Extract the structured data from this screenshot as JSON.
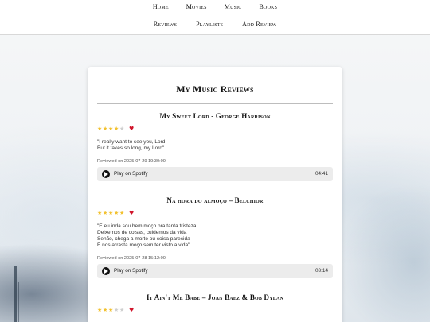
{
  "topnav": [
    {
      "label": "Home"
    },
    {
      "label": "Movies"
    },
    {
      "label": "Music"
    },
    {
      "label": "Books"
    }
  ],
  "subnav": [
    {
      "label": "Reviews"
    },
    {
      "label": "Playlists"
    },
    {
      "label": "Add Review"
    }
  ],
  "page": {
    "title": "My Music Reviews"
  },
  "reviews": [
    {
      "title": "My Sweet Lord - George Harrison",
      "rating": 4,
      "max_rating": 5,
      "favorite": true,
      "quote_lines": [
        "\"I really want to see you, Lord",
        "But it takes so long, my Lord\"."
      ],
      "reviewed": "Reviewed on 2025-07-29 19:30:00",
      "player_label": "Play on Spotify",
      "duration": "04:41"
    },
    {
      "title": "Na hora do almoço – Belchior",
      "rating": 5,
      "max_rating": 5,
      "favorite": true,
      "quote_lines": [
        "\"E eu inda sou bem moço pra tanta tristeza",
        "Deixemos de coisas, cuidemos da vida",
        "Senão, chega a morte ou coisa parecida",
        "E nos arrasta moço sem ter visto a vida\"."
      ],
      "reviewed": "Reviewed on 2025-07-28 15:12:00",
      "player_label": "Play on Spotify",
      "duration": "03:14"
    },
    {
      "title": "It Ain't Me Babe – Joan Baez & Bob Dylan",
      "rating": 3,
      "max_rating": 5,
      "favorite": true
    }
  ],
  "colors": {
    "star_filled": "#f2c12e",
    "star_empty": "#cfcfcf",
    "heart": "#d0142a",
    "player_bg": "#ececec"
  },
  "icons": {
    "star": "star-icon",
    "heart": "heart-icon",
    "play": "play-icon"
  }
}
